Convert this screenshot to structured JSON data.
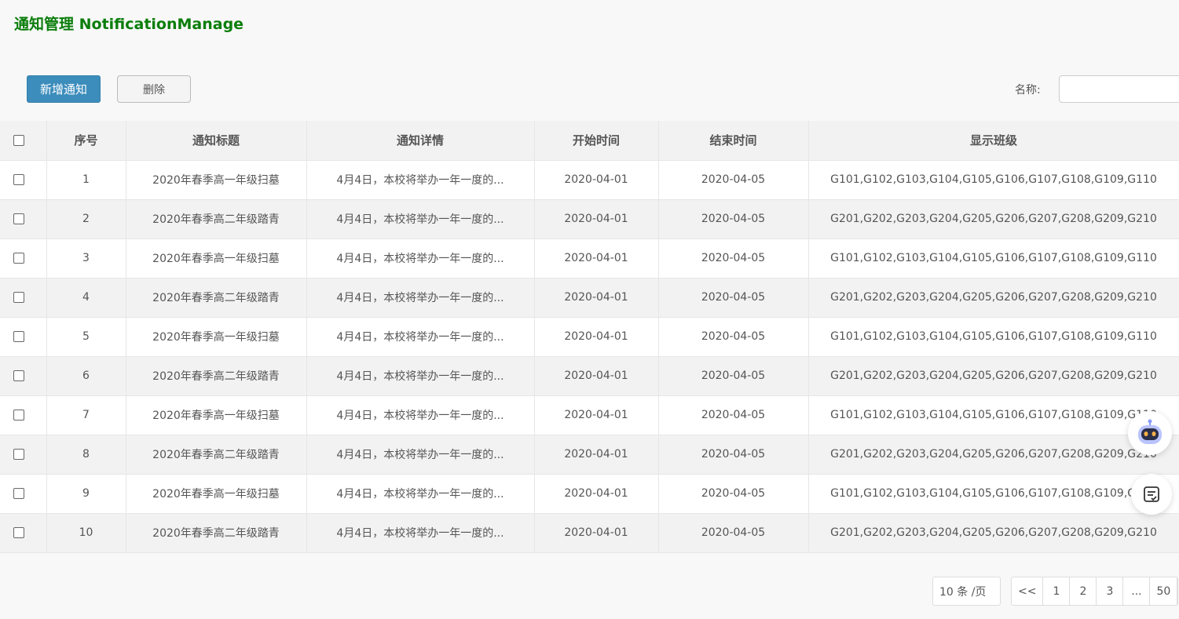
{
  "page": {
    "title": "通知管理 NotificationManage"
  },
  "toolbar": {
    "add_label": "新增通知",
    "delete_label": "删除",
    "search_label": "名称:",
    "search_value": ""
  },
  "table": {
    "headers": [
      "序号",
      "通知标题",
      "通知详情",
      "开始时间",
      "结束时间",
      "显示班级"
    ],
    "rows": [
      {
        "no": "1",
        "title": "2020年春季高一年级扫墓",
        "detail": "4月4日，本校将举办一年一度的...",
        "start": "2020-04-01",
        "end": "2020-04-05",
        "classes": "G101,G102,G103,G104,G105,G106,G107,G108,G109,G110"
      },
      {
        "no": "2",
        "title": "2020年春季高二年级踏青",
        "detail": "4月4日，本校将举办一年一度的...",
        "start": "2020-04-01",
        "end": "2020-04-05",
        "classes": "G201,G202,G203,G204,G205,G206,G207,G208,G209,G210"
      },
      {
        "no": "3",
        "title": "2020年春季高一年级扫墓",
        "detail": "4月4日，本校将举办一年一度的...",
        "start": "2020-04-01",
        "end": "2020-04-05",
        "classes": "G101,G102,G103,G104,G105,G106,G107,G108,G109,G110"
      },
      {
        "no": "4",
        "title": "2020年春季高二年级踏青",
        "detail": "4月4日，本校将举办一年一度的...",
        "start": "2020-04-01",
        "end": "2020-04-05",
        "classes": "G201,G202,G203,G204,G205,G206,G207,G208,G209,G210"
      },
      {
        "no": "5",
        "title": "2020年春季高一年级扫墓",
        "detail": "4月4日，本校将举办一年一度的...",
        "start": "2020-04-01",
        "end": "2020-04-05",
        "classes": "G101,G102,G103,G104,G105,G106,G107,G108,G109,G110"
      },
      {
        "no": "6",
        "title": "2020年春季高二年级踏青",
        "detail": "4月4日，本校将举办一年一度的...",
        "start": "2020-04-01",
        "end": "2020-04-05",
        "classes": "G201,G202,G203,G204,G205,G206,G207,G208,G209,G210"
      },
      {
        "no": "7",
        "title": "2020年春季高一年级扫墓",
        "detail": "4月4日，本校将举办一年一度的...",
        "start": "2020-04-01",
        "end": "2020-04-05",
        "classes": "G101,G102,G103,G104,G105,G106,G107,G108,G109,G110"
      },
      {
        "no": "8",
        "title": "2020年春季高二年级踏青",
        "detail": "4月4日，本校将举办一年一度的...",
        "start": "2020-04-01",
        "end": "2020-04-05",
        "classes": "G201,G202,G203,G204,G205,G206,G207,G208,G209,G210"
      },
      {
        "no": "9",
        "title": "2020年春季高一年级扫墓",
        "detail": "4月4日，本校将举办一年一度的...",
        "start": "2020-04-01",
        "end": "2020-04-05",
        "classes": "G101,G102,G103,G104,G105,G106,G107,G108,G109,G110"
      },
      {
        "no": "10",
        "title": "2020年春季高二年级踏青",
        "detail": "4月4日，本校将举办一年一度的...",
        "start": "2020-04-01",
        "end": "2020-04-05",
        "classes": "G201,G202,G203,G204,G205,G206,G207,G208,G209,G210"
      }
    ]
  },
  "pagination": {
    "page_size_label": "10 条 /页",
    "prev_label": "<<",
    "pages": [
      "1",
      "2",
      "3",
      "...",
      "50"
    ]
  },
  "icons": {
    "assistant": "robot-assistant-icon",
    "notes": "notes-icon"
  }
}
